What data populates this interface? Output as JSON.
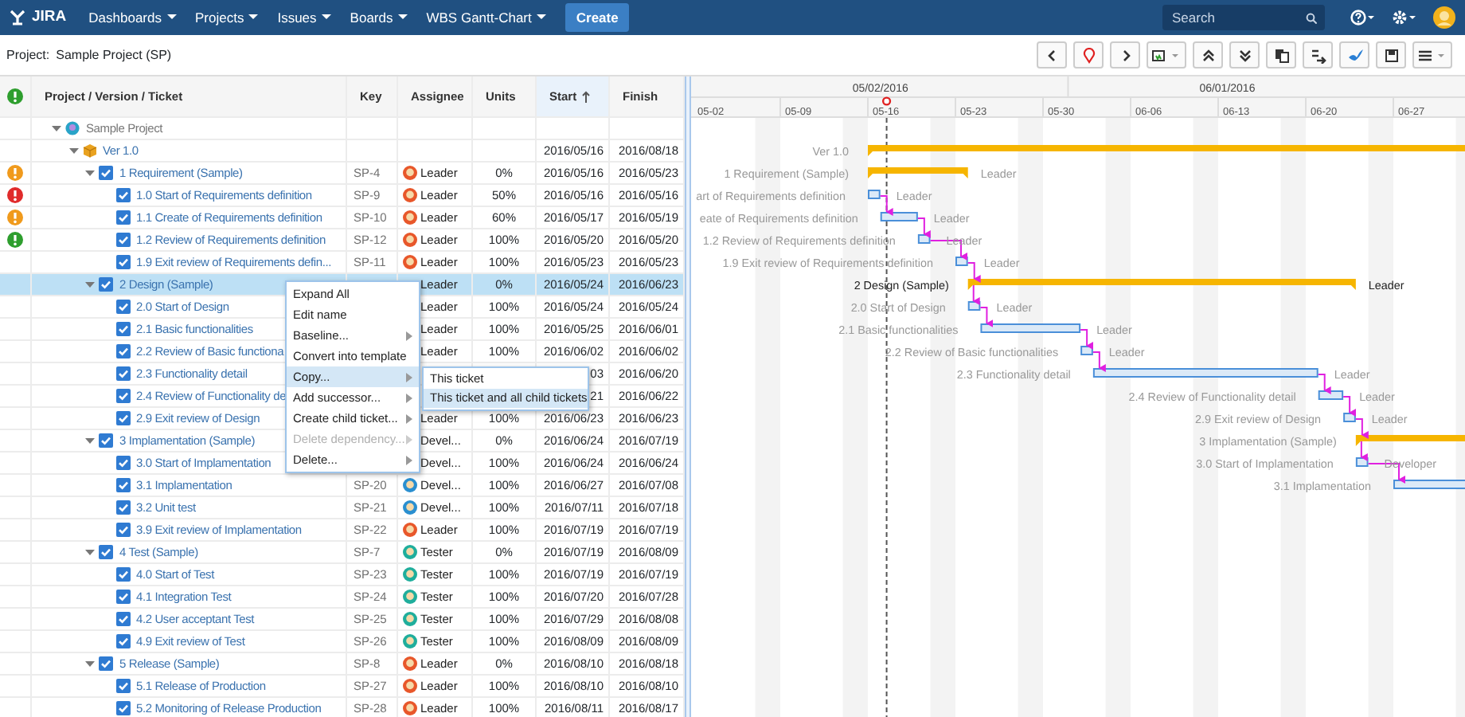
{
  "navbar": {
    "logo": "JIRA",
    "menus": [
      {
        "label": "Dashboards"
      },
      {
        "label": "Projects"
      },
      {
        "label": "Issues"
      },
      {
        "label": "Boards"
      },
      {
        "label": "WBS Gantt-Chart"
      }
    ],
    "create": "Create",
    "search": {
      "placeholder": "Search"
    }
  },
  "project": {
    "label": "Project:",
    "name": "Sample Project (SP)"
  },
  "table": {
    "columns": [
      {
        "label": "Project / Version / Ticket",
        "sorted": false
      },
      {
        "label": "Key",
        "sorted": false
      },
      {
        "label": "Assignee",
        "sorted": false
      },
      {
        "label": "Units",
        "sorted": false
      },
      {
        "label": "Start",
        "sorted": true
      },
      {
        "label": "Finish",
        "sorted": false
      }
    ],
    "tree": [
      {
        "kind": "project",
        "title": "Sample Project",
        "expanded": true,
        "selected": false,
        "children": [
          {
            "kind": "version",
            "title": "Ver 1.0",
            "start": "2016/05/16",
            "finish": "2016/08/18",
            "expanded": true,
            "selected": false,
            "children": [
              {
                "kind": "ticket",
                "title": "1 Requirement (Sample)",
                "key": "SP-4",
                "assignee": {
                  "name": "Leader",
                  "color": "#e8572a"
                },
                "units": "0%",
                "start": "2016/05/16",
                "finish": "2016/05/23",
                "color": "#f09a1c",
                "checked": true,
                "expanded": true,
                "selected": false,
                "children": [
                  {
                    "kind": "ticket",
                    "title": "1.0 Start of Requirements definition",
                    "key": "SP-9",
                    "assignee": {
                      "name": "Leader",
                      "color": "#e8572a"
                    },
                    "units": "50%",
                    "start": "2016/05/16",
                    "finish": "2016/05/16",
                    "color": "#e02b2b",
                    "checked": true,
                    "selected": false
                  },
                  {
                    "kind": "ticket",
                    "title": "1.1 Create of Requirements definition",
                    "key": "SP-10",
                    "assignee": {
                      "name": "Leader",
                      "color": "#e8572a"
                    },
                    "units": "60%",
                    "start": "2016/05/17",
                    "finish": "2016/05/19",
                    "color": "#f09a1c",
                    "checked": true,
                    "selected": false
                  },
                  {
                    "kind": "ticket",
                    "title": "1.2 Review of Requirements definition",
                    "key": "SP-12",
                    "assignee": {
                      "name": "Leader",
                      "color": "#e8572a"
                    },
                    "units": "100%",
                    "start": "2016/05/20",
                    "finish": "2016/05/20",
                    "color": "#2e9e2e",
                    "checked": true,
                    "selected": false
                  },
                  {
                    "kind": "ticket",
                    "title": "1.9 Exit review of Requirements defin...",
                    "key": "SP-11",
                    "assignee": {
                      "name": "Leader",
                      "color": "#e8572a"
                    },
                    "units": "100%",
                    "start": "2016/05/23",
                    "finish": "2016/05/23",
                    "checked": true,
                    "selected": false
                  }
                ]
              },
              {
                "kind": "ticket",
                "title": "2 Design (Sample)",
                "assignee": {
                  "name": "Leader"
                },
                "units": "0%",
                "start": "2016/05/24",
                "finish": "2016/06/23",
                "checked": true,
                "expanded": true,
                "selected": true,
                "children": [
                  {
                    "kind": "ticket",
                    "title": "2.0 Start of Design",
                    "assignee": {
                      "name": "Leader"
                    },
                    "units": "100%",
                    "start": "2016/05/24",
                    "finish": "2016/05/24",
                    "checked": true,
                    "selected": false
                  },
                  {
                    "kind": "ticket",
                    "title": "2.1 Basic functionalities",
                    "assignee": {
                      "name": "Leader"
                    },
                    "units": "100%",
                    "start": "2016/05/25",
                    "finish": "2016/06/01",
                    "checked": true,
                    "selected": false
                  },
                  {
                    "kind": "ticket",
                    "title": "2.2 Review of Basic functiona",
                    "assignee": {
                      "name": "Leader"
                    },
                    "units": "100%",
                    "start": "2016/06/02",
                    "finish": "2016/06/02",
                    "checked": true,
                    "selected": false
                  },
                  {
                    "kind": "ticket",
                    "title": "2.3 Functionality detail",
                    "start": "03",
                    "finish": "2016/06/20",
                    "checked": true,
                    "selected": false
                  },
                  {
                    "kind": "ticket",
                    "title": "2.4 Review of Functionality de",
                    "start": "21",
                    "finish": "2016/06/22",
                    "checked": true,
                    "selected": false
                  },
                  {
                    "kind": "ticket",
                    "title": "2.9 Exit review of Design",
                    "assignee": {
                      "name": "Leader"
                    },
                    "units": "100%",
                    "start": "2016/06/23",
                    "finish": "2016/06/23",
                    "checked": true,
                    "selected": false
                  }
                ]
              },
              {
                "kind": "ticket",
                "title": "3 Implamentation (Sample)",
                "assignee": {
                  "name": "Devel..."
                },
                "units": "0%",
                "start": "2016/06/24",
                "finish": "2016/07/19",
                "checked": true,
                "expanded": true,
                "selected": false,
                "children": [
                  {
                    "kind": "ticket",
                    "title": "3.0 Start of Implamentation",
                    "assignee": {
                      "name": "Devel..."
                    },
                    "units": "100%",
                    "start": "2016/06/24",
                    "finish": "2016/06/24",
                    "checked": true,
                    "selected": false
                  },
                  {
                    "kind": "ticket",
                    "title": "3.1 Implamentation",
                    "key": "SP-20",
                    "assignee": {
                      "name": "Devel...",
                      "color": "#2a8fd0"
                    },
                    "units": "100%",
                    "start": "2016/06/27",
                    "finish": "2016/07/08",
                    "checked": true,
                    "selected": false
                  },
                  {
                    "kind": "ticket",
                    "title": "3.2 Unit test",
                    "key": "SP-21",
                    "assignee": {
                      "name": "Devel...",
                      "color": "#2a8fd0"
                    },
                    "units": "100%",
                    "start": "2016/07/11",
                    "finish": "2016/07/18",
                    "checked": true,
                    "selected": false
                  },
                  {
                    "kind": "ticket",
                    "title": "3.9 Exit review of Implamentation",
                    "key": "SP-22",
                    "assignee": {
                      "name": "Leader",
                      "color": "#e8572a"
                    },
                    "units": "100%",
                    "start": "2016/07/19",
                    "finish": "2016/07/19",
                    "checked": true,
                    "selected": false
                  }
                ]
              },
              {
                "kind": "ticket",
                "title": "4 Test (Sample)",
                "key": "SP-7",
                "assignee": {
                  "name": "Tester",
                  "color": "#1fae9c"
                },
                "units": "0%",
                "start": "2016/07/19",
                "finish": "2016/08/09",
                "checked": true,
                "expanded": true,
                "selected": false,
                "children": [
                  {
                    "kind": "ticket",
                    "title": "4.0 Start of Test",
                    "key": "SP-23",
                    "assignee": {
                      "name": "Tester",
                      "color": "#1fae9c"
                    },
                    "units": "100%",
                    "start": "2016/07/19",
                    "finish": "2016/07/19",
                    "checked": true,
                    "selected": false
                  },
                  {
                    "kind": "ticket",
                    "title": "4.1 Integration Test",
                    "key": "SP-24",
                    "assignee": {
                      "name": "Tester",
                      "color": "#1fae9c"
                    },
                    "units": "100%",
                    "start": "2016/07/20",
                    "finish": "2016/07/28",
                    "checked": true,
                    "selected": false
                  },
                  {
                    "kind": "ticket",
                    "title": "4.2 User acceptant Test",
                    "key": "SP-25",
                    "assignee": {
                      "name": "Tester",
                      "color": "#1fae9c"
                    },
                    "units": "100%",
                    "start": "2016/07/29",
                    "finish": "2016/08/08",
                    "checked": true,
                    "selected": false
                  },
                  {
                    "kind": "ticket",
                    "title": "4.9 Exit review of Test",
                    "key": "SP-26",
                    "assignee": {
                      "name": "Tester",
                      "color": "#1fae9c"
                    },
                    "units": "100%",
                    "start": "2016/08/09",
                    "finish": "2016/08/09",
                    "checked": true,
                    "selected": false
                  }
                ]
              },
              {
                "kind": "ticket",
                "title": "5 Release (Sample)",
                "key": "SP-8",
                "assignee": {
                  "name": "Leader",
                  "color": "#e8572a"
                },
                "units": "0%",
                "start": "2016/08/10",
                "finish": "2016/08/18",
                "checked": true,
                "expanded": true,
                "selected": false,
                "children": [
                  {
                    "kind": "ticket",
                    "title": "5.1 Release of Production",
                    "key": "SP-27",
                    "assignee": {
                      "name": "Leader",
                      "color": "#e8572a"
                    },
                    "units": "100%",
                    "start": "2016/08/10",
                    "finish": "2016/08/10",
                    "checked": true,
                    "selected": false
                  },
                  {
                    "kind": "ticket",
                    "title": "5.2 Monitoring of Release Production",
                    "key": "SP-28",
                    "assignee": {
                      "name": "Leader",
                      "color": "#e8572a"
                    },
                    "units": "100%",
                    "start": "2016/08/11",
                    "finish": "2016/08/17",
                    "checked": true,
                    "selected": false
                  }
                ]
              }
            ]
          }
        ]
      }
    ]
  },
  "context_menu": {
    "items": [
      {
        "label": "Expand All",
        "submenu": false,
        "disabled": false,
        "selected": false
      },
      {
        "label": "Edit name",
        "submenu": false,
        "disabled": false,
        "selected": false
      },
      {
        "label": "Baseline...",
        "submenu": true,
        "disabled": false,
        "selected": false
      },
      {
        "label": "Convert into template",
        "submenu": false,
        "disabled": false,
        "selected": false
      },
      {
        "label": "Copy...",
        "submenu": true,
        "disabled": false,
        "selected": true
      },
      {
        "label": "Add successor...",
        "submenu": true,
        "disabled": false,
        "selected": false
      },
      {
        "label": "Create child ticket...",
        "submenu": true,
        "disabled": false,
        "selected": false
      },
      {
        "label": "Delete dependency...",
        "submenu": true,
        "disabled": true,
        "selected": false
      },
      {
        "label": "Delete...",
        "submenu": true,
        "disabled": false,
        "selected": false
      }
    ],
    "submenu": [
      {
        "label": "This ticket",
        "selected": false
      },
      {
        "label": "This ticket and all child tickets",
        "selected": true
      }
    ]
  },
  "gantt": {
    "months": [
      {
        "label": "05/02/2016"
      },
      {
        "label": "06/01/2016"
      }
    ],
    "weeks": [
      "05-02",
      "05-09",
      "05-16",
      "05-23",
      "05-30",
      "06-06",
      "06-13",
      "06-20",
      "06-27"
    ],
    "bars": [
      {
        "kind": "summary",
        "label": "Ver 1.0",
        "linked": false
      },
      {
        "kind": "summary",
        "label": "1 Requirement (Sample)",
        "resource": "Leader",
        "linked": false
      },
      {
        "kind": "task",
        "label": "art of Requirements definition",
        "resource": "Leader",
        "linked": false
      },
      {
        "kind": "task",
        "label": "eate of Requirements definition",
        "resource": "Leader",
        "linked": true
      },
      {
        "kind": "task",
        "label": "1.2 Review of Requirements definition",
        "resource": "Leader",
        "linked": true
      },
      {
        "kind": "task",
        "label": "1.9 Exit review of Requirements definition",
        "resource": "Leader",
        "linked": true
      },
      {
        "kind": "summary",
        "label": "2 Design (Sample)",
        "resource": "Leader",
        "linked": true
      },
      {
        "kind": "task",
        "label": "2.0 Start of Design",
        "resource": "Leader",
        "linked": true
      },
      {
        "kind": "task",
        "label": "2.1 Basic functionalities",
        "resource": "Leader",
        "linked": true
      },
      {
        "kind": "task",
        "label": "2.2 Review of Basic functionalities",
        "resource": "Leader",
        "linked": true
      },
      {
        "kind": "task",
        "label": "2.3 Functionality detail",
        "resource": "Leader",
        "linked": true
      },
      {
        "kind": "task",
        "label": "2.4 Review of Functionality detail",
        "resource": "Leader",
        "linked": true
      },
      {
        "kind": "task",
        "label": "2.9 Exit review of Design",
        "resource": "Leader",
        "linked": true
      },
      {
        "kind": "summary",
        "label": "3 Implamentation (Sample)",
        "linked": true
      },
      {
        "kind": "task",
        "label": "3.0 Start of Implamentation",
        "resource": "Developer",
        "linked": true
      },
      {
        "kind": "task",
        "label": "3.1 Implamentation",
        "linked": true
      }
    ]
  }
}
